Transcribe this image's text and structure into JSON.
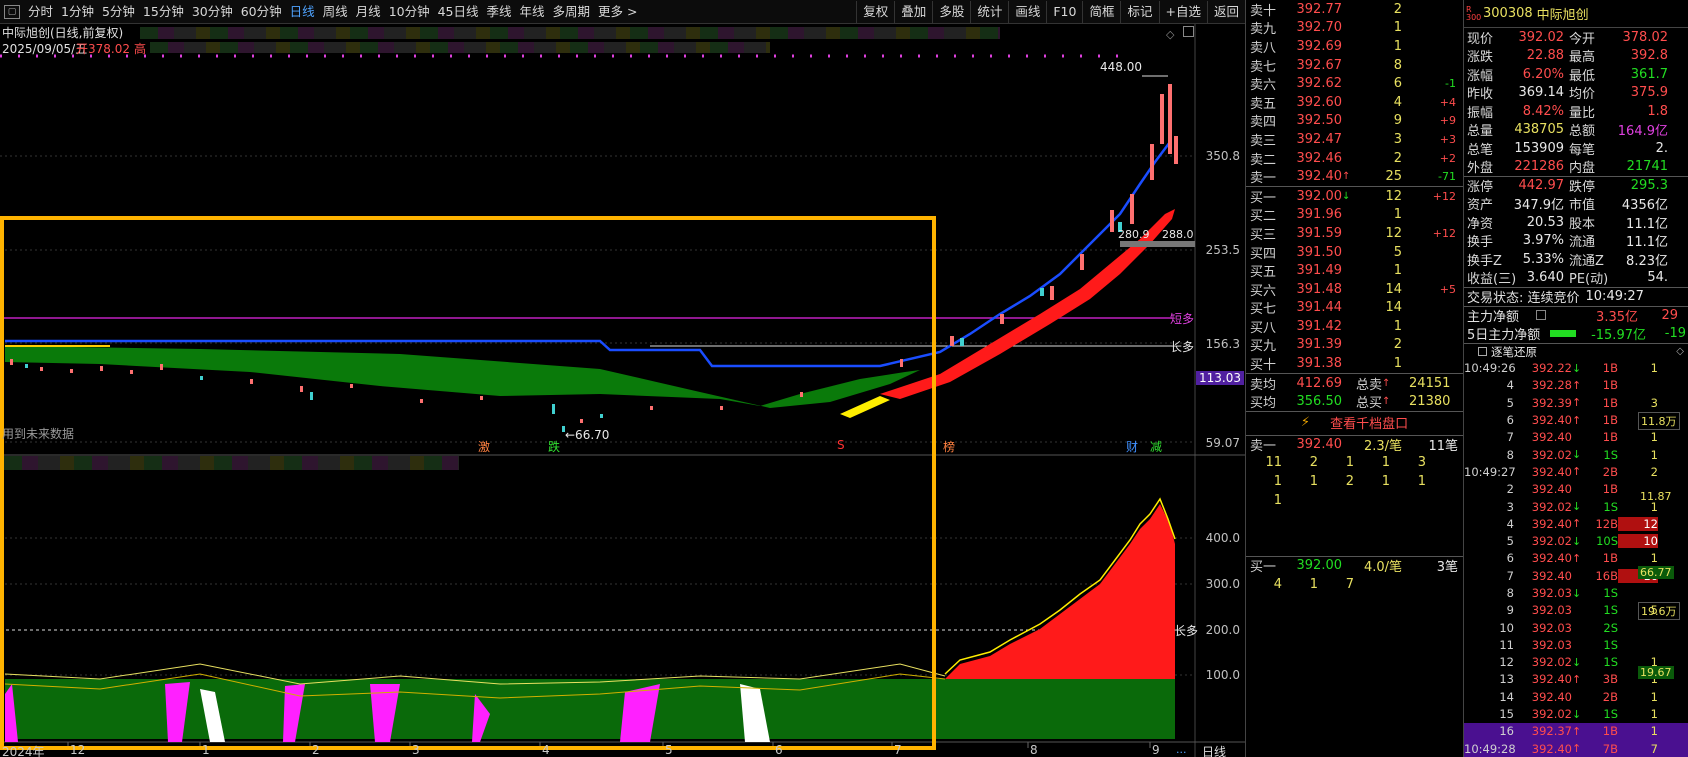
{
  "toolbar": {
    "periods": [
      "分时",
      "1分钟",
      "5分钟",
      "15分钟",
      "30分钟",
      "60分钟",
      "日线",
      "周线",
      "月线",
      "10分钟",
      "45日线",
      "季线",
      "年线",
      "多周期",
      "更多 >"
    ],
    "active": "日线",
    "right_buttons": [
      "复权",
      "叠加",
      "多股",
      "统计",
      "画线",
      "F10",
      "简框",
      "标记",
      "+自选",
      "返回"
    ]
  },
  "chart": {
    "title": "中际旭创(日线,前复权)",
    "date": "2025/09/05/五",
    "open_label": "开378.02",
    "high_label": "高",
    "y_labels": [
      "350.8",
      "253.5",
      "156.3",
      "59.07"
    ],
    "y_current": "113.03",
    "peak_label": "448.00",
    "low_label": "←66.70",
    "level_labels": [
      "280.9",
      "288.0"
    ],
    "short_tag": "短多",
    "long_tag": "长多",
    "future_note": "用到未来数据",
    "markers": [
      "激",
      "跌",
      "S",
      "榜",
      "财",
      "减"
    ],
    "indicator_y_labels": [
      "400.0",
      "300.0",
      "200.0",
      "100.0"
    ],
    "indicator_long_tag": "长多",
    "x_labels": [
      "2024年",
      "12",
      "1",
      "2",
      "3",
      "4",
      "5",
      "6",
      "7",
      "8",
      "9"
    ],
    "bottom_right": "日线",
    "ellipsis": "..."
  },
  "book": {
    "sells": [
      {
        "label": "卖十",
        "price": "392.77",
        "qty": "2",
        "chg": ""
      },
      {
        "label": "卖九",
        "price": "392.70",
        "qty": "1",
        "chg": ""
      },
      {
        "label": "卖八",
        "price": "392.69",
        "qty": "1",
        "chg": ""
      },
      {
        "label": "卖七",
        "price": "392.67",
        "qty": "8",
        "chg": ""
      },
      {
        "label": "卖六",
        "price": "392.62",
        "qty": "6",
        "chg": "-1"
      },
      {
        "label": "卖五",
        "price": "392.60",
        "qty": "4",
        "chg": "+4"
      },
      {
        "label": "卖四",
        "price": "392.50",
        "qty": "9",
        "chg": "+9"
      },
      {
        "label": "卖三",
        "price": "392.47",
        "qty": "3",
        "chg": "+3"
      },
      {
        "label": "卖二",
        "price": "392.46",
        "qty": "2",
        "chg": "+2"
      },
      {
        "label": "卖一",
        "price": "392.40",
        "qty": "25",
        "chg": "-71"
      }
    ],
    "buys": [
      {
        "label": "买一",
        "price": "392.00",
        "qty": "12",
        "chg": "+12"
      },
      {
        "label": "买二",
        "price": "391.96",
        "qty": "1",
        "chg": ""
      },
      {
        "label": "买三",
        "price": "391.59",
        "qty": "12",
        "chg": "+12"
      },
      {
        "label": "买四",
        "price": "391.50",
        "qty": "5",
        "chg": ""
      },
      {
        "label": "买五",
        "price": "391.49",
        "qty": "1",
        "chg": ""
      },
      {
        "label": "买六",
        "price": "391.48",
        "qty": "14",
        "chg": "+5"
      },
      {
        "label": "买七",
        "price": "391.44",
        "qty": "14",
        "chg": ""
      },
      {
        "label": "买八",
        "price": "391.42",
        "qty": "1",
        "chg": ""
      },
      {
        "label": "买九",
        "price": "391.39",
        "qty": "2",
        "chg": ""
      },
      {
        "label": "买十",
        "price": "391.38",
        "qty": "1",
        "chg": ""
      }
    ],
    "avg_sell_label": "卖均",
    "avg_sell": "412.69",
    "total_sell_label": "总卖",
    "total_sell": "24151",
    "avg_buy_label": "买均",
    "avg_buy": "356.50",
    "total_buy_label": "总买",
    "total_buy": "21380",
    "thousand_button": "查看千档盘口",
    "sell1_label": "卖一",
    "sell1_price": "392.40",
    "sell1_per": "2.3/笔",
    "sell1_count": "11笔",
    "sell1_detail": [
      [
        "11",
        "2",
        "1",
        "1",
        "3"
      ],
      [
        "1",
        "1",
        "2",
        "1",
        "1"
      ],
      [
        "1",
        "",
        "",
        "",
        ""
      ]
    ],
    "buy1_label": "买一",
    "buy1_price": "392.00",
    "buy1_per": "4.0/笔",
    "buy1_count": "3笔",
    "buy1_detail": [
      "4",
      "1",
      "7"
    ]
  },
  "info": {
    "badge": "R 300",
    "code": "300308",
    "name": "中际旭创",
    "rows": [
      {
        "k1": "现价",
        "v1": "392.02",
        "k2": "今开",
        "v2": "378.02"
      },
      {
        "k1": "涨跌",
        "v1": "22.88",
        "k2": "最高",
        "v2": "392.8"
      },
      {
        "k1": "涨幅",
        "v1": "6.20%",
        "k2": "最低",
        "v2": "361.7"
      },
      {
        "k1": "昨收",
        "v1": "369.14",
        "k2": "均价",
        "v2": "375.9"
      },
      {
        "k1": "振幅",
        "v1": "8.42%",
        "k2": "量比",
        "v2": "1.8"
      },
      {
        "k1": "总量",
        "v1": "438705",
        "k2": "总额",
        "v2": "164.9亿"
      },
      {
        "k1": "总笔",
        "v1": "153909",
        "k2": "每笔",
        "v2": "2."
      },
      {
        "k1": "外盘",
        "v1": "221286",
        "k2": "内盘",
        "v2": "21741"
      },
      {
        "k1": "涨停",
        "v1": "442.97",
        "k2": "跌停",
        "v2": "295.3"
      },
      {
        "k1": "资产",
        "v1": "347.9亿",
        "k2": "市值",
        "v2": "4356亿"
      },
      {
        "k1": "净资",
        "v1": "20.53",
        "k2": "股本",
        "v2": "11.1亿"
      },
      {
        "k1": "换手",
        "v1": "3.97%",
        "k2": "流通",
        "v2": "11.1亿"
      },
      {
        "k1": "换手Z",
        "v1": "5.33%",
        "k2": "流通Z",
        "v2": "8.23亿"
      },
      {
        "k1": "收益(三)",
        "v1": "3.640",
        "k2": "PE(动)",
        "v2": "54."
      }
    ],
    "trade_status": "交易状态: 连续竞价",
    "trade_time": "10:49:27",
    "main_net_label": "主力净额",
    "main_net": "3.35亿",
    "main_net_extra": "29",
    "main5_label": "5日主力净额",
    "main5": "-15.97亿",
    "main5_extra": "-19",
    "ticks_title": "逐笔还原",
    "ticks": [
      {
        "t": "10:49:26",
        "p": "392.22",
        "d": "↓",
        "v": "1B",
        "n": "1"
      },
      {
        "t": "4",
        "p": "392.28",
        "d": "↑",
        "v": "1B",
        "n": ""
      },
      {
        "t": "5",
        "p": "392.39",
        "d": "↑",
        "v": "1B",
        "n": "3"
      },
      {
        "t": "6",
        "p": "392.40",
        "d": "↑",
        "v": "1B",
        "n": ""
      },
      {
        "t": "7",
        "p": "392.40",
        "d": "",
        "v": "1B",
        "n": "1"
      },
      {
        "t": "8",
        "p": "392.02",
        "d": "↓",
        "v": "1S",
        "n": "1"
      },
      {
        "t": "10:49:27",
        "p": "392.40",
        "d": "↑",
        "v": "2B",
        "n": "2"
      },
      {
        "t": "2",
        "p": "392.40",
        "d": "",
        "v": "1B",
        "n": ""
      },
      {
        "t": "3",
        "p": "392.02",
        "d": "↓",
        "v": "1S",
        "n": "1"
      },
      {
        "t": "4",
        "p": "392.40",
        "d": "↑",
        "v": "12B",
        "n": "12"
      },
      {
        "t": "5",
        "p": "392.02",
        "d": "↓",
        "v": "10S",
        "n": "10"
      },
      {
        "t": "6",
        "p": "392.40",
        "d": "↑",
        "v": "1B",
        "n": "1"
      },
      {
        "t": "7",
        "p": "392.40",
        "d": "",
        "v": "16B",
        "n": "16"
      },
      {
        "t": "8",
        "p": "392.03",
        "d": "↓",
        "v": "1S",
        "n": ""
      },
      {
        "t": "9",
        "p": "392.03",
        "d": "",
        "v": "1S",
        "n": "5"
      },
      {
        "t": "10",
        "p": "392.03",
        "d": "",
        "v": "2S",
        "n": ""
      },
      {
        "t": "11",
        "p": "392.03",
        "d": "",
        "v": "1S",
        "n": ""
      },
      {
        "t": "12",
        "p": "392.02",
        "d": "↓",
        "v": "1S",
        "n": "1"
      },
      {
        "t": "13",
        "p": "392.40",
        "d": "↑",
        "v": "3B",
        "n": "1"
      },
      {
        "t": "14",
        "p": "392.40",
        "d": "",
        "v": "2B",
        "n": "1"
      },
      {
        "t": "15",
        "p": "392.02",
        "d": "↓",
        "v": "1S",
        "n": "1"
      },
      {
        "t": "16",
        "p": "392.37",
        "d": "↑",
        "v": "1B",
        "n": "1"
      },
      {
        "t": "10:49:28",
        "p": "392.40",
        "d": "↑",
        "v": "7B",
        "n": "7"
      }
    ],
    "tick_groups": [
      "11.8万",
      "11.87",
      "66.77",
      "19.6万",
      "19.67"
    ]
  },
  "colors": {
    "up": "#ff4d4d",
    "down": "#22dd22",
    "accent": "#4fa3ff",
    "highlight": "#ffb300"
  }
}
